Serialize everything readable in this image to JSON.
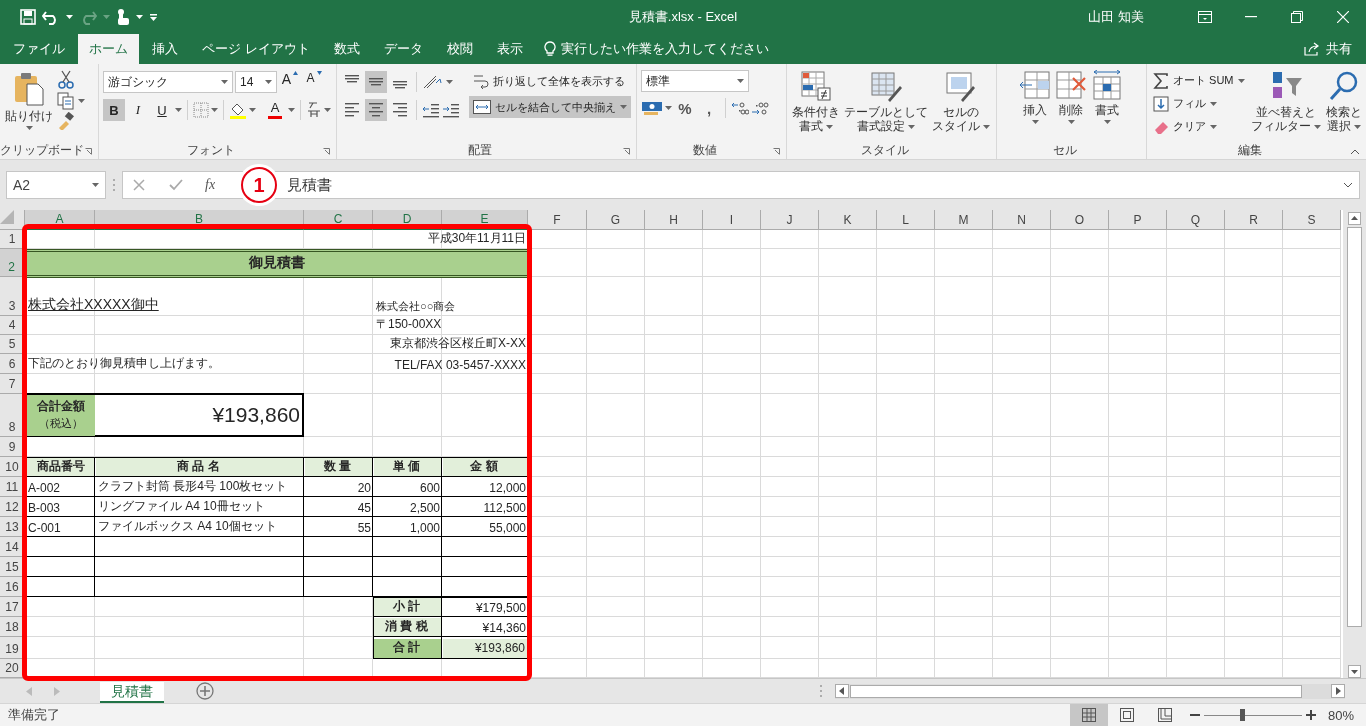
{
  "window": {
    "title": "見積書.xlsx - Excel",
    "user": "山田 知美"
  },
  "tabs": [
    {
      "label": "ファイル",
      "selected": false
    },
    {
      "label": "ホーム",
      "selected": true
    },
    {
      "label": "挿入",
      "selected": false
    },
    {
      "label": "ページ レイアウト",
      "selected": false
    },
    {
      "label": "数式",
      "selected": false
    },
    {
      "label": "データ",
      "selected": false
    },
    {
      "label": "校閲",
      "selected": false
    },
    {
      "label": "表示",
      "selected": false
    }
  ],
  "tell_me": "実行したい作業を入力してください",
  "share": "共有",
  "ribbon": {
    "groups": [
      {
        "kind": "clipboard",
        "label": "クリップボード",
        "paste": "貼り付け"
      },
      {
        "kind": "font",
        "label": "フォント",
        "font": "游ゴシック",
        "size": "14",
        "size_glyphs": [
          "A",
          "A"
        ],
        "toggles": [
          {
            "label": "B",
            "on": true
          },
          {
            "label": "I",
            "on": false
          },
          {
            "label": "U",
            "on": false
          }
        ],
        "color_glyph": "A"
      },
      {
        "kind": "alignment",
        "label": "配置",
        "align": [
          {
            "on": false
          },
          {
            "on": true
          },
          {
            "on": false
          },
          {
            "on": false
          },
          {
            "on": true
          },
          {
            "on": false
          }
        ],
        "wrap": {
          "label": "折り返して全体を表示する",
          "on": false
        },
        "merge": {
          "label": "セルを結合して中央揃え",
          "on": true
        }
      },
      {
        "kind": "number",
        "label": "数値",
        "format": "標準",
        "symbols": [
          "%",
          ","
        ]
      },
      {
        "kind": "large",
        "label": "スタイル",
        "buttons": [
          {
            "lines": [
              "条件付き",
              "書式"
            ]
          },
          {
            "lines": [
              "テーブルとして",
              "書式設定"
            ]
          },
          {
            "lines": [
              "セルの",
              "スタイル"
            ]
          }
        ]
      },
      {
        "kind": "cells",
        "label": "セル",
        "buttons": [
          {
            "lines": [
              "挿入"
            ]
          },
          {
            "lines": [
              "削除"
            ]
          },
          {
            "lines": [
              "書式"
            ]
          }
        ]
      },
      {
        "kind": "editing",
        "label": "編集",
        "small": [
          "オート SUM",
          "フィル",
          "クリア"
        ],
        "buttons": [
          {
            "lines": [
              "並べ替えと",
              "フィルター"
            ]
          },
          {
            "lines": [
              "検索と",
              "選択"
            ]
          }
        ]
      }
    ]
  },
  "formula_bar": {
    "name_box": "A2",
    "function_label": "fx",
    "formula": "見積書"
  },
  "annotation": {
    "badge": "1"
  },
  "sheet": {
    "columns": [
      {
        "label": "A",
        "selected": true
      },
      {
        "label": "B",
        "selected": true
      },
      {
        "label": "C",
        "selected": true
      },
      {
        "label": "D",
        "selected": true
      },
      {
        "label": "E",
        "selected": true
      },
      {
        "label": "F",
        "selected": false
      },
      {
        "label": "G",
        "selected": false
      },
      {
        "label": "H",
        "selected": false
      },
      {
        "label": "I",
        "selected": false
      },
      {
        "label": "J",
        "selected": false
      },
      {
        "label": "K",
        "selected": false
      },
      {
        "label": "L",
        "selected": false
      },
      {
        "label": "M",
        "selected": false
      },
      {
        "label": "N",
        "selected": false
      },
      {
        "label": "O",
        "selected": false
      },
      {
        "label": "P",
        "selected": false
      },
      {
        "label": "Q",
        "selected": false
      },
      {
        "label": "R",
        "selected": false
      },
      {
        "label": "S",
        "selected": false
      }
    ],
    "rows": [
      {
        "label": "1",
        "selected": false
      },
      {
        "label": "2",
        "selected": true
      },
      {
        "label": "3",
        "selected": false
      },
      {
        "label": "4",
        "selected": false
      },
      {
        "label": "5",
        "selected": false
      },
      {
        "label": "6",
        "selected": false
      },
      {
        "label": "7",
        "selected": false
      },
      {
        "label": "8",
        "selected": false
      },
      {
        "label": "9",
        "selected": false
      },
      {
        "label": "10",
        "selected": false
      },
      {
        "label": "11",
        "selected": false
      },
      {
        "label": "12",
        "selected": false
      },
      {
        "label": "13",
        "selected": false
      },
      {
        "label": "14",
        "selected": false
      },
      {
        "label": "15",
        "selected": false
      },
      {
        "label": "16",
        "selected": false
      },
      {
        "label": "17",
        "selected": false
      },
      {
        "label": "18",
        "selected": false
      },
      {
        "label": "19",
        "selected": false
      },
      {
        "label": "20",
        "selected": false
      }
    ],
    "cells": [
      {
        "text": "平成30年11月11日",
        "kind": "right"
      },
      {
        "text": "御見積書",
        "kind": "title"
      },
      {
        "text": "株式会社XXXXX御中",
        "kind": "addressee"
      },
      {
        "text": "株式会社○○商会",
        "kind": "small"
      },
      {
        "text": "〒150-00XX",
        "kind": "left"
      },
      {
        "text": "東京都渋谷区桜丘町X-XX",
        "kind": "right"
      },
      {
        "text": "下記のとおり御見積申し上げます。",
        "kind": "left"
      },
      {
        "text": "TEL/FAX 03-5457-XXXX",
        "kind": "right"
      },
      {
        "text": "合計金額",
        "note": "（税込）",
        "kind": "label"
      },
      {
        "text": "¥193,860",
        "kind": "amount"
      },
      {
        "text": "商品番号",
        "kind": "header"
      },
      {
        "text": "商品名",
        "kind": "header-wide"
      },
      {
        "text": "数量",
        "kind": "header-wide"
      },
      {
        "text": "単価",
        "kind": "header-wide"
      },
      {
        "text": "金額",
        "kind": "header-wide"
      },
      {
        "text": "A-002",
        "kind": "left"
      },
      {
        "text": "クラフト封筒 長形4号 100枚セット",
        "kind": "left"
      },
      {
        "text": "20",
        "kind": "right"
      },
      {
        "text": "600",
        "kind": "right"
      },
      {
        "text": "12,000",
        "kind": "right"
      },
      {
        "text": "B-003",
        "kind": "left"
      },
      {
        "text": "リングファイル A4 10冊セット",
        "kind": "left"
      },
      {
        "text": "45",
        "kind": "right"
      },
      {
        "text": "2,500",
        "kind": "right"
      },
      {
        "text": "112,500",
        "kind": "right"
      },
      {
        "text": "C-001",
        "kind": "left"
      },
      {
        "text": "ファイルボックス A4 10個セット",
        "kind": "left"
      },
      {
        "text": "55",
        "kind": "right"
      },
      {
        "text": "1,000",
        "kind": "right"
      },
      {
        "text": "55,000",
        "kind": "right"
      },
      {
        "text": "小計",
        "kind": "header-wide"
      },
      {
        "text": "¥179,500",
        "kind": "right"
      },
      {
        "text": "消費税",
        "kind": "header-wide"
      },
      {
        "text": "¥14,360",
        "kind": "right"
      },
      {
        "text": "合計",
        "kind": "total-label"
      },
      {
        "text": "¥193,860",
        "kind": "total"
      }
    ]
  },
  "sheet_tabs": [
    {
      "label": "見積書",
      "selected": true
    }
  ],
  "status_bar": {
    "text": "準備完了",
    "views": [
      {
        "selected": true
      },
      {
        "selected": false
      },
      {
        "selected": false
      }
    ],
    "zoom": {
      "level": 0.39,
      "reading": "80%"
    }
  }
}
